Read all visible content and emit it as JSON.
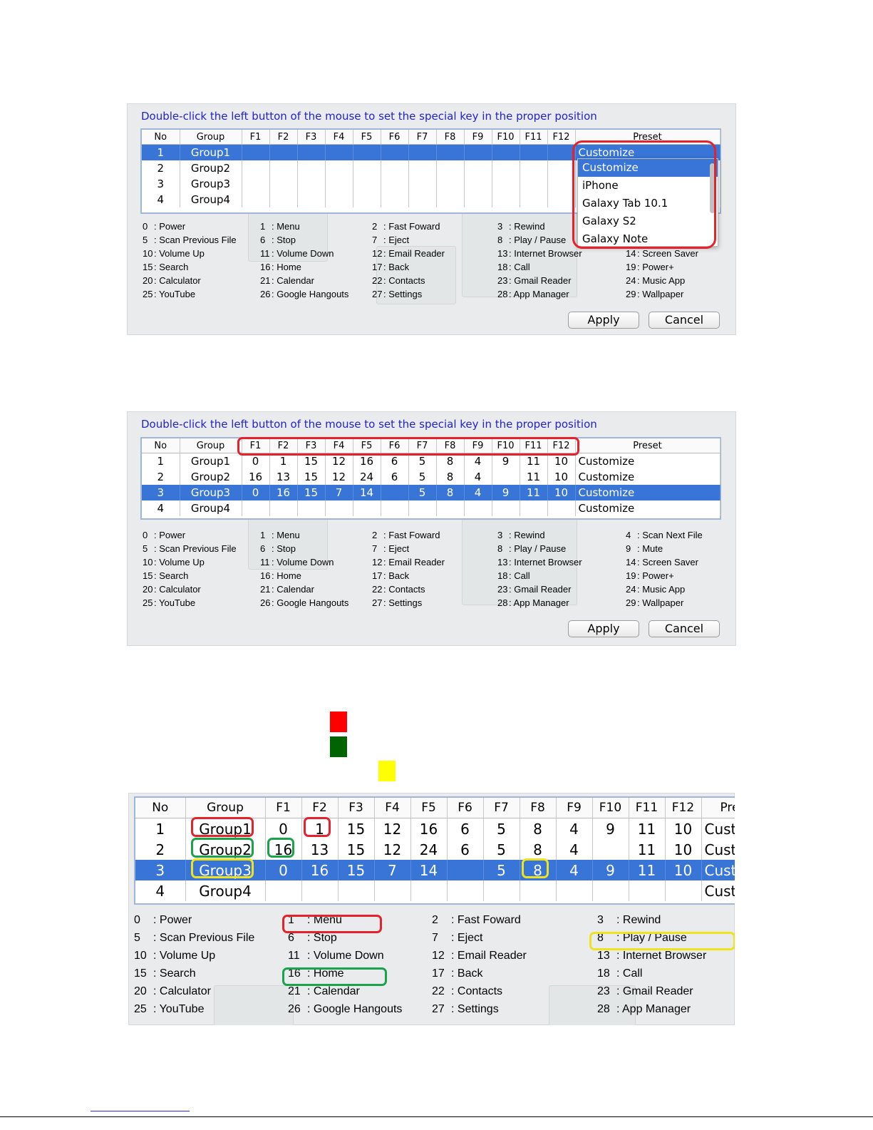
{
  "instruction": "Double-click the left button of the mouse to set the special key in the proper position",
  "headers": [
    "No",
    "Group",
    "F1",
    "F2",
    "F3",
    "F4",
    "F5",
    "F6",
    "F7",
    "F8",
    "F9",
    "F10",
    "F11",
    "F12",
    "Preset"
  ],
  "panel1": {
    "rows": [
      {
        "no": "1",
        "group": "Group1",
        "preset": "Customize"
      },
      {
        "no": "2",
        "group": "Group2"
      },
      {
        "no": "3",
        "group": "Group3"
      },
      {
        "no": "4",
        "group": "Group4"
      }
    ],
    "dropdown": {
      "selected": "Customize",
      "options": [
        "Customize",
        "iPhone",
        "Galaxy Tab 10.1",
        "Galaxy S2",
        "Galaxy Note"
      ]
    }
  },
  "panel2": {
    "rows": [
      {
        "no": "1",
        "group": "Group1",
        "keys": [
          "0",
          "1",
          "15",
          "12",
          "16",
          "6",
          "5",
          "8",
          "4",
          "9",
          "11",
          "10"
        ],
        "preset": "Customize"
      },
      {
        "no": "2",
        "group": "Group2",
        "keys": [
          "16",
          "13",
          "15",
          "12",
          "24",
          "6",
          "5",
          "8",
          "4",
          "",
          "11",
          "10"
        ],
        "preset": "Customize"
      },
      {
        "no": "3",
        "group": "Group3",
        "keys": [
          "0",
          "16",
          "15",
          "7",
          "14",
          "",
          "5",
          "8",
          "4",
          "9",
          "11",
          "10"
        ],
        "preset": "Customize"
      },
      {
        "no": "4",
        "group": "Group4",
        "keys": [
          "",
          "",
          "",
          "",
          "",
          "",
          "",
          "",
          "",
          "",
          "",
          ""
        ],
        "preset": "Customize"
      }
    ]
  },
  "panel3": {
    "rows": [
      {
        "no": "1",
        "group": "Group1",
        "keys": [
          "0",
          "1",
          "15",
          "12",
          "16",
          "6",
          "5",
          "8",
          "4",
          "9",
          "11",
          "10"
        ],
        "preset": "Custo"
      },
      {
        "no": "2",
        "group": "Group2",
        "keys": [
          "16",
          "13",
          "15",
          "12",
          "24",
          "6",
          "5",
          "8",
          "4",
          "",
          "11",
          "10"
        ],
        "preset": "Custo"
      },
      {
        "no": "3",
        "group": "Group3",
        "keys": [
          "0",
          "16",
          "15",
          "7",
          "14",
          "",
          "5",
          "8",
          "4",
          "9",
          "11",
          "10"
        ],
        "preset": "Cust"
      },
      {
        "no": "4",
        "group": "Group4",
        "keys": [
          "",
          "",
          "",
          "",
          "",
          "",
          "",
          "",
          "",
          "",
          "",
          ""
        ],
        "preset": "Custo"
      }
    ]
  },
  "legend": [
    {
      "n": "0",
      "t": ": Power"
    },
    {
      "n": "1",
      "t": ": Menu"
    },
    {
      "n": "2",
      "t": ": Fast Foward"
    },
    {
      "n": "3",
      "t": ": Rewind"
    },
    {
      "n": "4",
      "t": ": Scan Next File"
    },
    {
      "n": "5",
      "t": ": Scan Previous File"
    },
    {
      "n": "6",
      "t": ": Stop"
    },
    {
      "n": "7",
      "t": ": Eject"
    },
    {
      "n": "8",
      "t": ": Play / Pause"
    },
    {
      "n": "9",
      "t": ": Mute"
    },
    {
      "n": "10",
      "t": ": Volume Up"
    },
    {
      "n": "11",
      "t": ": Volume Down"
    },
    {
      "n": "12",
      "t": ": Email Reader"
    },
    {
      "n": "13",
      "t": ": Internet Browser"
    },
    {
      "n": "14",
      "t": ": Screen Saver"
    },
    {
      "n": "15",
      "t": ": Search"
    },
    {
      "n": "16",
      "t": ": Home"
    },
    {
      "n": "17",
      "t": ": Back"
    },
    {
      "n": "18",
      "t": ": Call"
    },
    {
      "n": "19",
      "t": ": Power+"
    },
    {
      "n": "20",
      "t": ": Calculator"
    },
    {
      "n": "21",
      "t": ": Calendar"
    },
    {
      "n": "22",
      "t": ": Contacts"
    },
    {
      "n": "23",
      "t": ": Gmail Reader"
    },
    {
      "n": "24",
      "t": ": Music App"
    },
    {
      "n": "25",
      "t": ": YouTube"
    },
    {
      "n": "26",
      "t": ": Google Hangouts"
    },
    {
      "n": "27",
      "t": ": Settings"
    },
    {
      "n": "28",
      "t": ": App Manager"
    },
    {
      "n": "29",
      "t": ": Wallpaper"
    }
  ],
  "buttons": {
    "apply": "Apply",
    "cancel": "Cancel"
  },
  "colors": {
    "selection": "#3875d7",
    "title": "#2323c8",
    "swatch_red": "#ff0000",
    "swatch_green": "#006400",
    "swatch_yellow": "#ffff00"
  }
}
